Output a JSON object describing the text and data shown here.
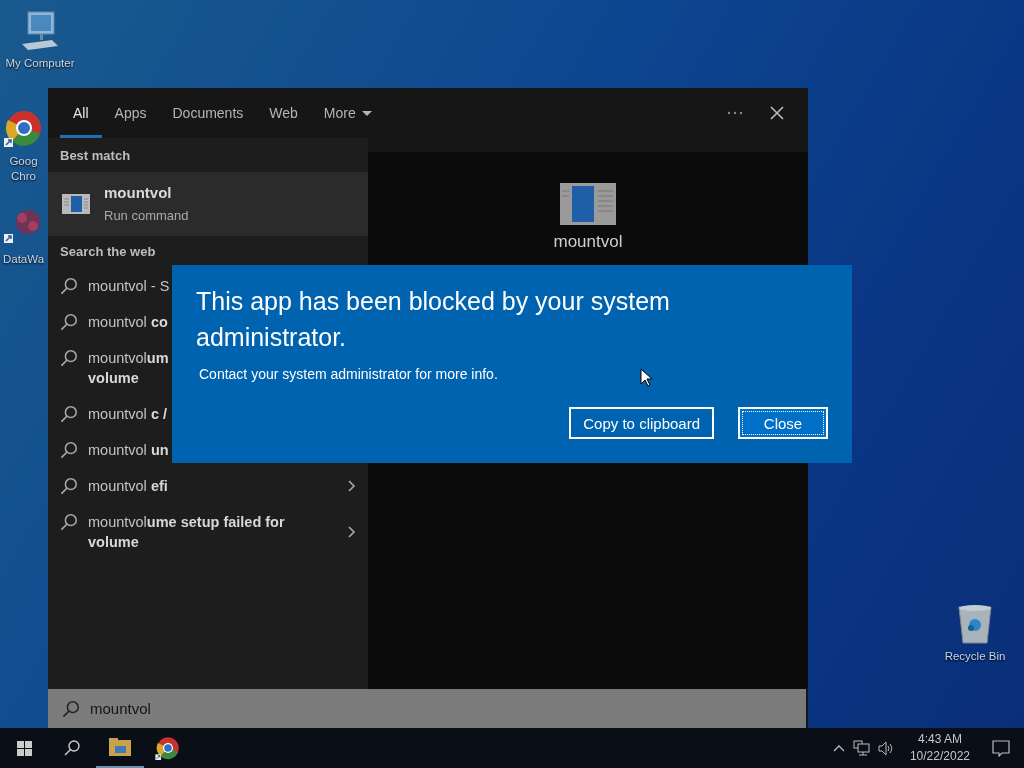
{
  "desktop_icons": [
    {
      "kind": "computer",
      "lines": [
        "My Computer"
      ]
    },
    {
      "kind": "browser",
      "lines": [
        "Goog",
        "Chro"
      ]
    },
    {
      "kind": "app",
      "lines": [
        "DataWa"
      ]
    },
    {
      "kind": "recycle",
      "lines": [
        "Recycle Bin"
      ]
    }
  ],
  "search_panel": {
    "tabs": [
      {
        "label": "All",
        "selected": true,
        "dropdown": false
      },
      {
        "label": "Apps",
        "selected": false,
        "dropdown": false
      },
      {
        "label": "Documents",
        "selected": false,
        "dropdown": false
      },
      {
        "label": "Web",
        "selected": false,
        "dropdown": false
      },
      {
        "label": "More",
        "selected": false,
        "dropdown": true
      }
    ],
    "best_match": {
      "heading": "Best match",
      "title": "mountvol",
      "subtitle": "Run command"
    },
    "web": {
      "heading": "Search the web",
      "items": [
        {
          "lines": [
            "mountvol - S"
          ]
        },
        {
          "lines": [
            "mountvol **co**"
          ]
        },
        {
          "lines": [
            "mountvol**um**",
            "**volume**"
          ]
        },
        {
          "lines": [
            "mountvol **c /**"
          ]
        },
        {
          "lines": [
            "mountvol **un**"
          ]
        },
        {
          "lines": [
            "mountvol **efi**"
          ],
          "arrow": true
        },
        {
          "lines": [
            "mountvol**ume setup failed for**",
            "**volume**"
          ],
          "arrow": true
        }
      ]
    },
    "preview": {
      "title": "mountvol"
    },
    "search_box": {
      "value": "mountvol"
    }
  },
  "dialog": {
    "title": "This app has been blocked by your system administrator.",
    "message": "Contact your system administrator for more info.",
    "buttons": [
      {
        "label": "Copy to clipboard",
        "focused": false
      },
      {
        "label": "Close",
        "focused": true
      }
    ]
  },
  "taskbar": {
    "time": "4:43 AM",
    "date": "10/22/2022"
  }
}
